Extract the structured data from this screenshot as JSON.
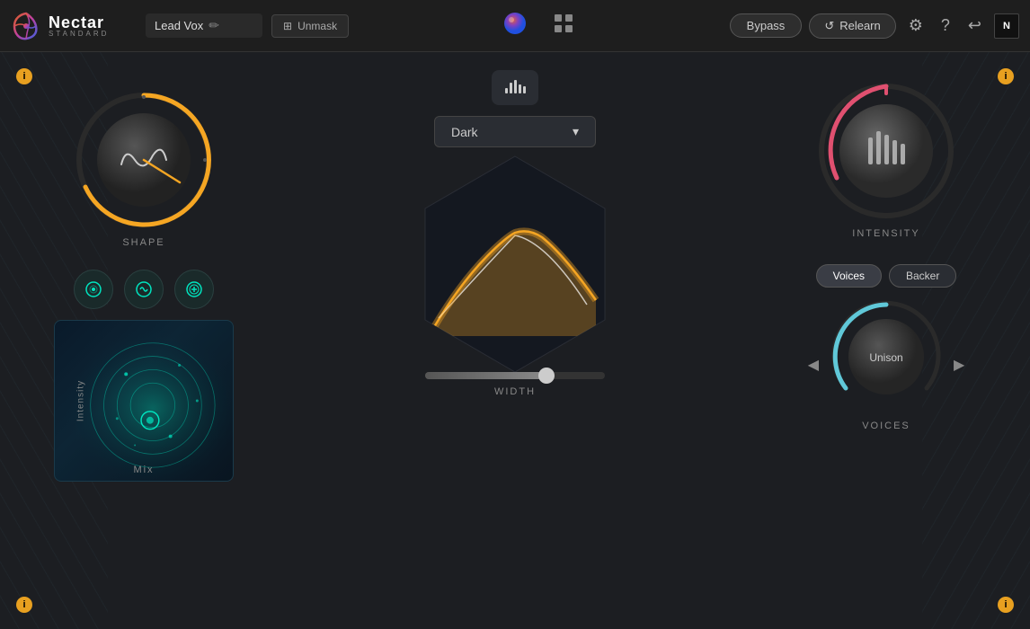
{
  "app": {
    "title": "Nectar",
    "subtitle": "STANDARD"
  },
  "header": {
    "preset_name": "Lead Vox",
    "unmask_label": "Unmask",
    "bypass_label": "Bypass",
    "relearn_label": "Relearn",
    "nav_icons": [
      "circle-dot",
      "grid",
      "bars"
    ]
  },
  "main": {
    "info_dots": [
      "ⓘ",
      "ⓘ",
      "ⓘ",
      "ⓘ"
    ],
    "left": {
      "shape_label": "SHAPE",
      "mix_label": "Mix",
      "intensity_side_label": "Intensity"
    },
    "center": {
      "eq_label": "Dark",
      "width_label": "WIDTH"
    },
    "right": {
      "intensity_label": "INTENSITY",
      "voices_label": "VOICES",
      "voices_tab": "Voices",
      "backer_tab": "Backer",
      "unison_label": "Unison"
    }
  },
  "colors": {
    "orange": "#f5a623",
    "pink": "#e05070",
    "teal": "#00e5c0",
    "dark_bg": "#1c1e22",
    "panel_bg": "#22262e"
  }
}
